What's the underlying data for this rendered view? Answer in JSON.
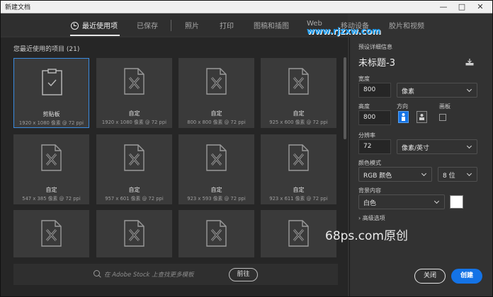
{
  "window": {
    "title": "新建文档",
    "minimize": "—",
    "maximize": "□",
    "close": "✕"
  },
  "tabs": [
    {
      "label": "最近使用项",
      "active": true
    },
    {
      "label": "已保存"
    },
    {
      "label": "照片"
    },
    {
      "label": "打印"
    },
    {
      "label": "图稿和插图"
    },
    {
      "label": "Web"
    },
    {
      "label": "移动设备"
    },
    {
      "label": "胶片和视频"
    }
  ],
  "recent": {
    "title": "您最近使用的项目",
    "count": "(21)",
    "items": [
      {
        "name": "剪贴板",
        "size": "1920 x 1080 像素 @ 72 ppi",
        "selected": true,
        "icon": "clipboard-icon"
      },
      {
        "name": "自定",
        "size": "1920 x 1080 像素 @ 72 ppi",
        "icon": "custom-doc-icon"
      },
      {
        "name": "自定",
        "size": "800 x 800 像素 @ 72 ppi",
        "icon": "custom-doc-icon"
      },
      {
        "name": "自定",
        "size": "925 x 600 像素 @ 72 ppi",
        "icon": "custom-doc-icon"
      },
      {
        "name": "自定",
        "size": "547 x 385 像素 @ 72 ppi",
        "icon": "custom-doc-icon"
      },
      {
        "name": "自定",
        "size": "957 x 601 像素 @ 72 ppi",
        "icon": "custom-doc-icon"
      },
      {
        "name": "自定",
        "size": "923 x 593 像素 @ 72 ppi",
        "icon": "custom-doc-icon"
      },
      {
        "name": "自定",
        "size": "923 x 611 像素 @ 72 ppi",
        "icon": "custom-doc-icon"
      },
      {
        "name": "",
        "size": "",
        "icon": "custom-doc-icon"
      },
      {
        "name": "",
        "size": "",
        "icon": "custom-doc-icon"
      },
      {
        "name": "",
        "size": "",
        "icon": "custom-doc-icon"
      },
      {
        "name": "",
        "size": "",
        "icon": "custom-doc-icon"
      }
    ]
  },
  "stock": {
    "placeholder": "在 Adobe Stock 上查找更多模板",
    "go_label": "前往"
  },
  "preset": {
    "section_label": "预设详细信息",
    "doc_name": "未标题-3",
    "width_label": "宽度",
    "width_value": "800",
    "width_unit": "像素",
    "height_label": "高度",
    "height_value": "800",
    "orientation_label": "方向",
    "artboard_label": "画板",
    "resolution_label": "分辨率",
    "resolution_value": "72",
    "resolution_unit": "像素/英寸",
    "color_mode_label": "颜色模式",
    "color_mode_value": "RGB 颜色",
    "bit_depth_value": "8 位",
    "background_label": "背景内容",
    "background_value": "白色",
    "advanced_label": "高级选项",
    "close_label": "关闭",
    "create_label": "创建"
  },
  "watermarks": {
    "top": "www.rjzxw.com",
    "bottom": "68ps.com原创"
  },
  "colors": {
    "accent": "#1473e6",
    "selected_border": "#3b8ce0"
  }
}
